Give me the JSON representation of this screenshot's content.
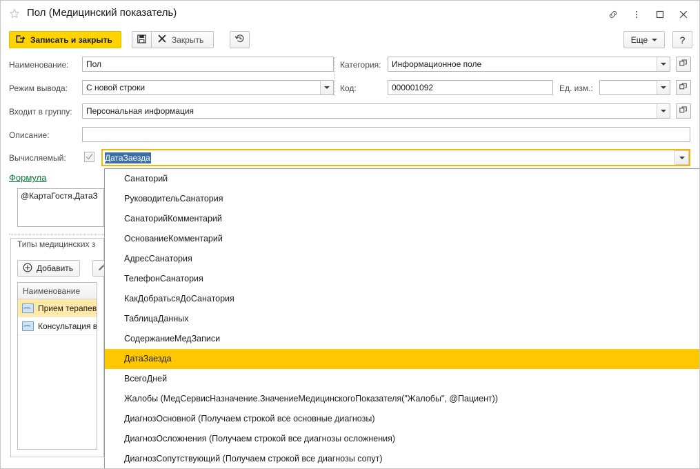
{
  "window": {
    "title": "Пол (Медицинский показатель)",
    "icons": {
      "favorite": "star-icon",
      "link": "link-icon",
      "menu": "kebab-menu-icon",
      "maximize": "maximize-icon",
      "close": "close-icon"
    }
  },
  "commandbar": {
    "save_and_close": "Записать и закрыть",
    "save_icon": "floppy-save-icon",
    "close": "Закрыть",
    "history_icon": "history-clock-icon",
    "more": "Еще",
    "help": "?"
  },
  "form": {
    "fields": [
      {
        "label": "Наименование:",
        "value": "Пол"
      },
      {
        "label": "Режим вывода:",
        "value": "С новой строки"
      },
      {
        "label": "Входит в группу:",
        "value": "Персональная информация"
      },
      {
        "label": "Описание:",
        "value": ""
      },
      {
        "label": "Вычисляемый:",
        "value": ""
      }
    ],
    "right_fields": [
      {
        "label": "Категория:",
        "value": "Информационное поле"
      },
      {
        "label": "Код:",
        "value": "000001092"
      },
      {
        "label": "Ед. изм.:",
        "value": ""
      }
    ],
    "calculated_checked": true,
    "combo_value": "ДатаЗаезда"
  },
  "formula": {
    "link": "Формула",
    "text": "@КартаГостя.ДатаЗ"
  },
  "panel": {
    "title": "Типы медицинских з",
    "add_button": "Добавить",
    "add_icon": "plus-circle-icon",
    "edit_icon": "pencil-edit-icon",
    "grid": {
      "column": "Наименование",
      "rows": [
        {
          "label": "Прием терапев",
          "icon": "record-type-icon",
          "selected": true
        },
        {
          "label": "Консультация в",
          "icon": "record-type-icon",
          "selected": false
        }
      ]
    }
  },
  "dropdown": {
    "items": [
      {
        "label": "Санаторий",
        "highlighted": false
      },
      {
        "label": "РуководительСанатория",
        "highlighted": false
      },
      {
        "label": "СанаторийКомментарий",
        "highlighted": false
      },
      {
        "label": "ОснованиеКомментарий",
        "highlighted": false
      },
      {
        "label": "АдресСанатория",
        "highlighted": false
      },
      {
        "label": "ТелефонСанатория",
        "highlighted": false
      },
      {
        "label": "КакДобратьсяДоСанатория",
        "highlighted": false
      },
      {
        "label": "ТаблицаДанных",
        "highlighted": false
      },
      {
        "label": "СодержаниеМедЗаписи",
        "highlighted": false
      },
      {
        "label": "ДатаЗаезда",
        "highlighted": true
      },
      {
        "label": "ВсегоДней",
        "highlighted": false
      },
      {
        "label": "Жалобы (МедСервисНазначение.ЗначениеМедицинскогоПоказателя(\"Жалобы\", @Пациент))",
        "highlighted": false
      },
      {
        "label": "ДиагнозОсновной (Получаем строкой все основные диагнозы)",
        "highlighted": false
      },
      {
        "label": "ДиагнозОсложнения (Получаем строкой все диагнозы осложнения)",
        "highlighted": false
      },
      {
        "label": "ДиагнозСопутствующий (Получаем строкой все диагнозы сопут)",
        "highlighted": false
      }
    ]
  },
  "colors": {
    "accent_yellow": "#ffd400",
    "highlight_yellow": "#ffc800",
    "focus_border": "#f5b700",
    "link_green": "#0a7a3c",
    "selection_blue": "#3a6ea5",
    "row_selected": "#ffe9a8"
  }
}
